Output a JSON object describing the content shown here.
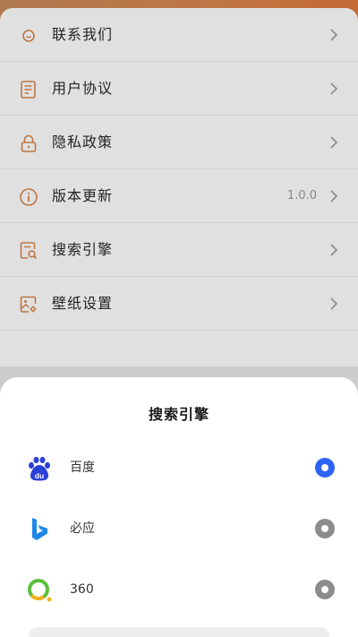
{
  "colors": {
    "accent": "#d9874e",
    "selected": "#2f63f5",
    "unselected": "#8c8c8c"
  },
  "menu": {
    "items": [
      {
        "label": "联系我们",
        "icon": "smile-chat-icon",
        "value": ""
      },
      {
        "label": "用户协议",
        "icon": "document-icon",
        "value": ""
      },
      {
        "label": "隐私政策",
        "icon": "lock-icon",
        "value": ""
      },
      {
        "label": "版本更新",
        "icon": "info-icon",
        "value": "1.0.0"
      },
      {
        "label": "搜索引擎",
        "icon": "search-document-icon",
        "value": ""
      },
      {
        "label": "壁纸设置",
        "icon": "image-settings-icon",
        "value": ""
      }
    ]
  },
  "sheet": {
    "title": "搜索引擎",
    "engines": [
      {
        "name": "百度",
        "logo": "baidu-logo-icon",
        "selected": true
      },
      {
        "name": "必应",
        "logo": "bing-logo-icon",
        "selected": false
      },
      {
        "name": "360",
        "logo": "360-logo-icon",
        "selected": false
      }
    ]
  }
}
